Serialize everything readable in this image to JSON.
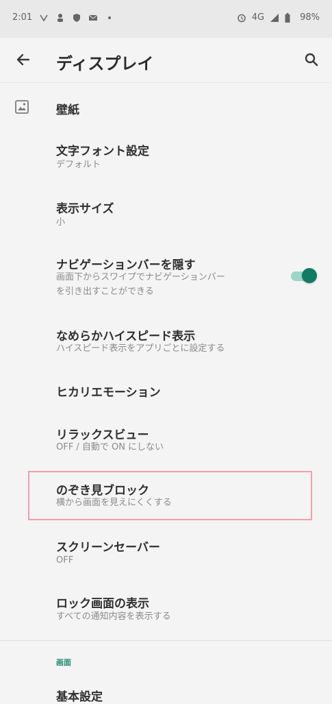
{
  "status_bar": {
    "time": "2:01",
    "network": "4G",
    "battery": "98%",
    "left_icons": [
      "vpn-icon",
      "person-icon",
      "shield-icon",
      "mail-icon",
      "dot-icon"
    ],
    "right_icons": [
      "alarm-icon",
      "signal-icon",
      "battery-icon"
    ]
  },
  "toolbar": {
    "title": "ディスプレイ",
    "back_icon": "arrow-left-icon",
    "search_icon": "search-icon"
  },
  "settings": {
    "wallpaper": {
      "title": "壁紙",
      "icon": "wallpaper-icon"
    },
    "font": {
      "title": "文字フォント設定",
      "subtitle": "デフォルト"
    },
    "display_size": {
      "title": "表示サイズ",
      "subtitle": "小"
    },
    "nav_bar": {
      "title": "ナビゲーションバーを隠す",
      "subtitle_line1": "画面下からスワイプでナビゲーションバー",
      "subtitle_line2": "を引き出すことができる",
      "enabled": true
    },
    "high_speed": {
      "title": "なめらかハイスピード表示",
      "subtitle": "ハイスピード表示をアプリごとに設定する"
    },
    "hikari_emotion": {
      "title": "ヒカリエモーション"
    },
    "relax_view": {
      "title": "リラックスビュー",
      "subtitle": "OFF / 自動で ON にしない"
    },
    "peek_block": {
      "title": "のぞき見ブロック",
      "subtitle": "横から画面を見えにくくする"
    },
    "screen_saver": {
      "title": "スクリーンセーバー",
      "subtitle": "OFF"
    },
    "lock_screen": {
      "title": "ロック画面の表示",
      "subtitle": "すべての通知内容を表示する"
    }
  },
  "section": {
    "label": "画面",
    "basic_settings": "基本設定"
  },
  "colors": {
    "accent": "#137a63",
    "highlight_border": "#f0a0a6"
  }
}
